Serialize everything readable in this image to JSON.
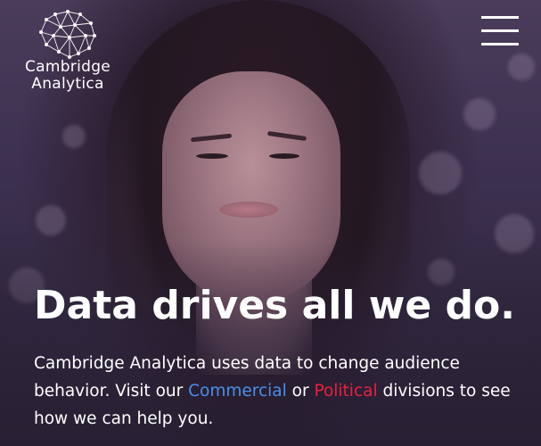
{
  "logo": {
    "line1": "Cambridge",
    "line2": "Analytica",
    "icon": "brain-network-icon"
  },
  "menu": {
    "icon": "hamburger-menu-icon"
  },
  "hero": {
    "headline": "Data drives all we do.",
    "body_before": "Cambridge Analytica uses data to change audience behavior. Visit our ",
    "link_commercial": "Commercial",
    "body_middle": " or ",
    "link_political": "Political",
    "body_after": " divisions to see how we can help you."
  },
  "colors": {
    "commercial_link": "#4a8fe8",
    "political_link": "#e8213c",
    "text": "#ffffff"
  }
}
